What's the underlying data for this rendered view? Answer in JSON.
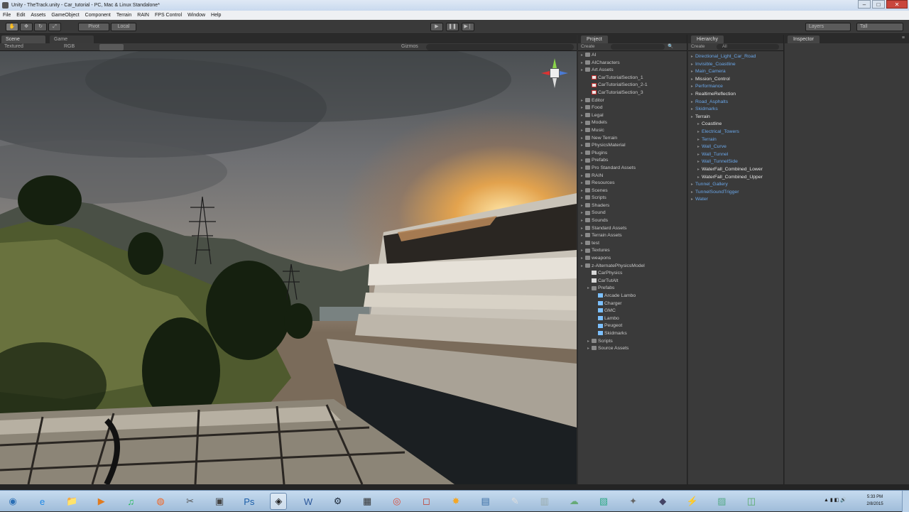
{
  "window": {
    "title": "Unity - TheTrack.unity - Car_tutorial - PC, Mac & Linux Standalone*"
  },
  "menu": [
    "File",
    "Edit",
    "Assets",
    "GameObject",
    "Component",
    "Terrain",
    "RAIN",
    "FPS Control",
    "Window",
    "Help"
  ],
  "toolbar": {
    "pivot": "Pivot",
    "local": "Local",
    "layers": "Layers",
    "layout": "Tall"
  },
  "scene": {
    "tabs": [
      "Scene",
      "Game"
    ],
    "shading": "Textured",
    "mode": "RGB",
    "gizmos": "Gizmos"
  },
  "project": {
    "tab": "Project",
    "create": "Create",
    "items": [
      {
        "label": "AI",
        "type": "folder",
        "indent": 0
      },
      {
        "label": "AICharacters",
        "type": "folder",
        "indent": 0
      },
      {
        "label": "Art Assets",
        "type": "folder",
        "indent": 0
      },
      {
        "label": "CarTutorialSection_1",
        "type": "scene",
        "indent": 1
      },
      {
        "label": "CarTutorialSection_2-1",
        "type": "scene",
        "indent": 1
      },
      {
        "label": "CarTutorialSection_3",
        "type": "scene",
        "indent": 1
      },
      {
        "label": "Editor",
        "type": "folder",
        "indent": 0
      },
      {
        "label": "Food",
        "type": "folder",
        "indent": 0
      },
      {
        "label": "Legal",
        "type": "folder",
        "indent": 0
      },
      {
        "label": "Models",
        "type": "folder",
        "indent": 0
      },
      {
        "label": "Music",
        "type": "folder",
        "indent": 0
      },
      {
        "label": "New Terrain",
        "type": "folder",
        "indent": 0
      },
      {
        "label": "PhysicsMaterial",
        "type": "folder",
        "indent": 0
      },
      {
        "label": "Plugins",
        "type": "folder",
        "indent": 0
      },
      {
        "label": "Prefabs",
        "type": "folder",
        "indent": 0
      },
      {
        "label": "Pro Standard Assets",
        "type": "folder",
        "indent": 0
      },
      {
        "label": "RAIN",
        "type": "folder",
        "indent": 0
      },
      {
        "label": "Resources",
        "type": "folder",
        "indent": 0
      },
      {
        "label": "Scenes",
        "type": "folder",
        "indent": 0
      },
      {
        "label": "Scripts",
        "type": "folder",
        "indent": 0
      },
      {
        "label": "Shaders",
        "type": "folder",
        "indent": 0
      },
      {
        "label": "Sound",
        "type": "folder",
        "indent": 0
      },
      {
        "label": "Sounds",
        "type": "folder",
        "indent": 0
      },
      {
        "label": "Standard Assets",
        "type": "folder",
        "indent": 0
      },
      {
        "label": "Terrain Assets",
        "type": "folder",
        "indent": 0
      },
      {
        "label": "test",
        "type": "folder",
        "indent": 0
      },
      {
        "label": "Textures",
        "type": "folder",
        "indent": 0
      },
      {
        "label": "weapons",
        "type": "folder",
        "indent": 0
      },
      {
        "label": "z-AlternatePhysicsModel",
        "type": "folder",
        "indent": 0
      },
      {
        "label": "CarPhysics",
        "type": "script",
        "indent": 1
      },
      {
        "label": "CarTutAlt",
        "type": "script",
        "indent": 1
      },
      {
        "label": "Prefabs",
        "type": "folder",
        "indent": 1
      },
      {
        "label": "Arcade Lambo",
        "type": "prefab",
        "indent": 2
      },
      {
        "label": "Charger",
        "type": "prefab",
        "indent": 2
      },
      {
        "label": "GMC",
        "type": "prefab",
        "indent": 2
      },
      {
        "label": "Lambo",
        "type": "prefab",
        "indent": 2
      },
      {
        "label": "Peugeot",
        "type": "prefab",
        "indent": 2
      },
      {
        "label": "Skidmarks",
        "type": "prefab",
        "indent": 2
      },
      {
        "label": "Scripts",
        "type": "folder",
        "indent": 1
      },
      {
        "label": "Source Assets",
        "type": "folder",
        "indent": 1
      }
    ]
  },
  "hierarchy": {
    "tab": "Hierarchy",
    "create": "Create",
    "all": "All",
    "items": [
      {
        "label": "Directional_Light_Car_Road",
        "color": "blue",
        "indent": 0
      },
      {
        "label": "Invisible_Coastline",
        "color": "blue",
        "indent": 0
      },
      {
        "label": "Main_Camera",
        "color": "blue",
        "indent": 0
      },
      {
        "label": "Mission_Control",
        "color": "white",
        "indent": 0
      },
      {
        "label": "Performance",
        "color": "blue",
        "indent": 0
      },
      {
        "label": "RealtimeReflection",
        "color": "white",
        "indent": 0
      },
      {
        "label": "Road_Asphalts",
        "color": "blue",
        "indent": 0
      },
      {
        "label": "Skidmarks",
        "color": "blue",
        "indent": 0
      },
      {
        "label": "Terrain",
        "color": "white",
        "indent": 0
      },
      {
        "label": "Coastline",
        "color": "white",
        "indent": 1
      },
      {
        "label": "Electrical_Towers",
        "color": "blue",
        "indent": 1
      },
      {
        "label": "Terrain",
        "color": "blue",
        "indent": 1
      },
      {
        "label": "Wall_Curve",
        "color": "blue",
        "indent": 1
      },
      {
        "label": "Wall_Tunnel",
        "color": "blue",
        "indent": 1
      },
      {
        "label": "Wall_TunnelSide",
        "color": "blue",
        "indent": 1
      },
      {
        "label": "WaterFall_Combined_Lower",
        "color": "white",
        "indent": 1
      },
      {
        "label": "WaterFall_Combined_Upper",
        "color": "white",
        "indent": 1
      },
      {
        "label": "Tunnel_Gallery",
        "color": "blue",
        "indent": 0
      },
      {
        "label": "TunnelSoundTrigger",
        "color": "blue",
        "indent": 0
      },
      {
        "label": "Water",
        "color": "blue",
        "indent": 0
      }
    ]
  },
  "inspector": {
    "tab": "Inspector"
  },
  "taskbar": {
    "icons": [
      "start-orb",
      "ie",
      "explorer",
      "media",
      "spotify",
      "origin",
      "tool",
      "steam-like",
      "photoshop",
      "unity",
      "word",
      "steam",
      "unknown",
      "chrome",
      "app",
      "blender",
      "app2",
      "notepad",
      "app3",
      "app4",
      "app5",
      "app6",
      "app7",
      "app8",
      "app9",
      "app10"
    ],
    "active": "unity",
    "time": "5:33 PM",
    "date": "2/8/2015"
  }
}
